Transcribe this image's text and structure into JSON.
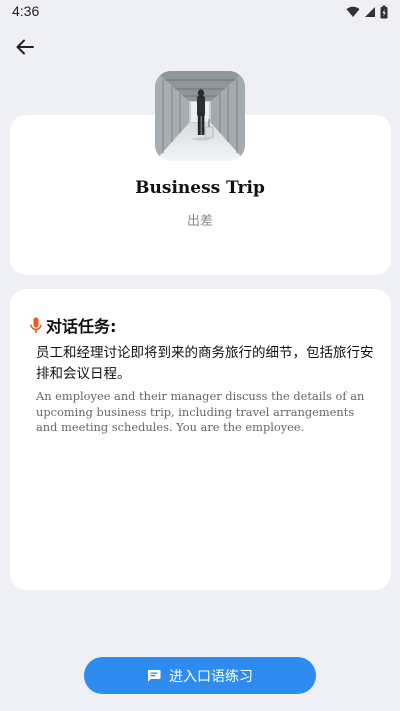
{
  "status_bar": {
    "time": "4:36",
    "icons": [
      "wifi-icon",
      "signal-icon",
      "battery-icon"
    ]
  },
  "header": {
    "back_icon": "arrow-left-icon"
  },
  "topic": {
    "title": "Business Trip",
    "subtitle": "出差",
    "image": "businessman-corridor-photo"
  },
  "task": {
    "icon": "microphone-icon",
    "heading": "对话任务:",
    "description_cn": "员工和经理讨论即将到来的商务旅行的细节，包括旅行安排和会议日程。",
    "description_en": "An employee and their manager discuss the details of an upcoming business trip, including travel arrangements and meeting schedules. You are the employee."
  },
  "action": {
    "icon": "chat-icon",
    "label": "进入口语练习"
  },
  "colors": {
    "background": "#EEF0F6",
    "card": "#FFFFFF",
    "accent_blue": "#2E8CF0",
    "mic_orange": "#F05A22"
  }
}
